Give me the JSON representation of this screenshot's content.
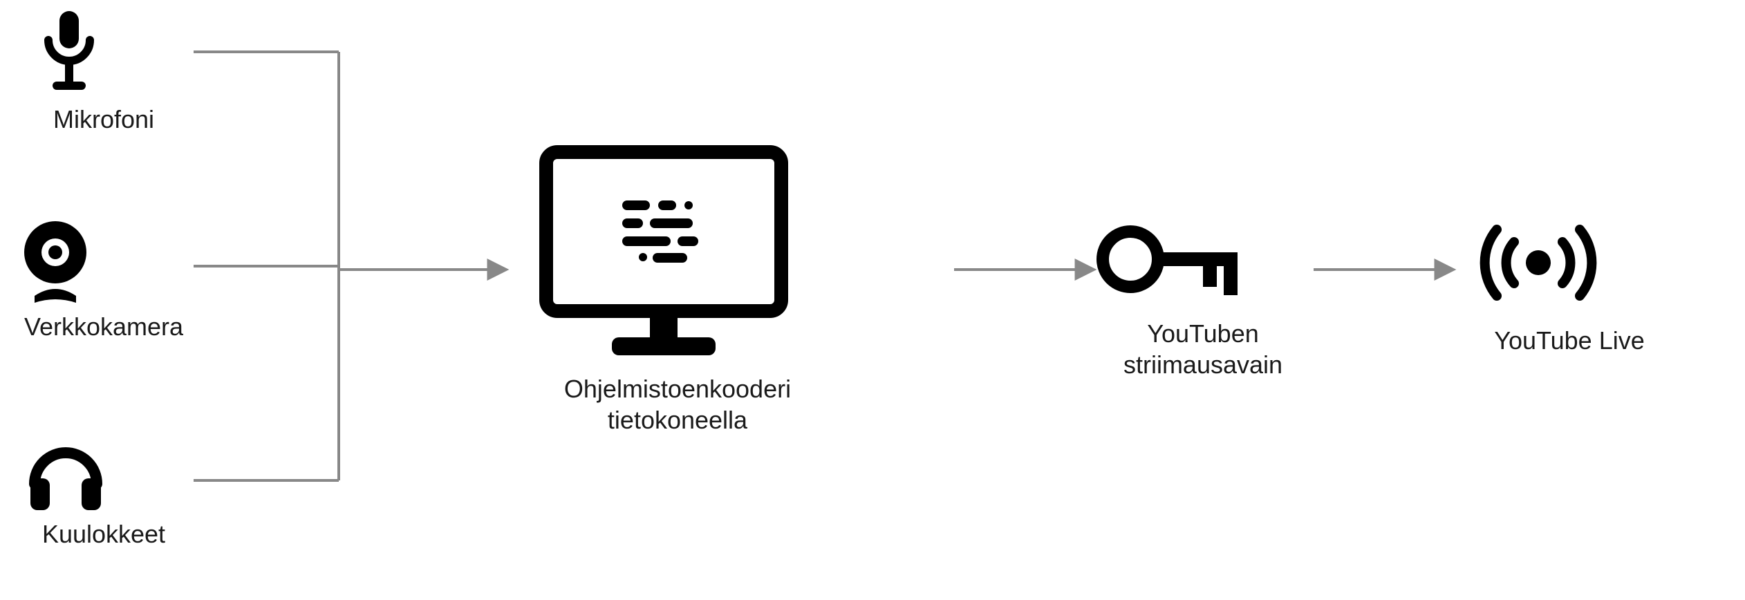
{
  "inputs": {
    "mic": {
      "label": "Mikrofoni",
      "icon": "microphone-icon"
    },
    "webcam": {
      "label": "Verkkokamera",
      "icon": "webcam-icon"
    },
    "head": {
      "label": "Kuulokkeet",
      "icon": "headphones-icon"
    }
  },
  "encoder": {
    "label": "Ohjelmistoenkooderi\ntietokoneella",
    "icon": "monitor-icon"
  },
  "streamkey": {
    "label": "YouTuben\nstriimausavain",
    "icon": "key-icon"
  },
  "live": {
    "label": "YouTube Live",
    "icon": "broadcast-icon"
  },
  "colors": {
    "icon": "#000000",
    "arrow": "#888888"
  }
}
